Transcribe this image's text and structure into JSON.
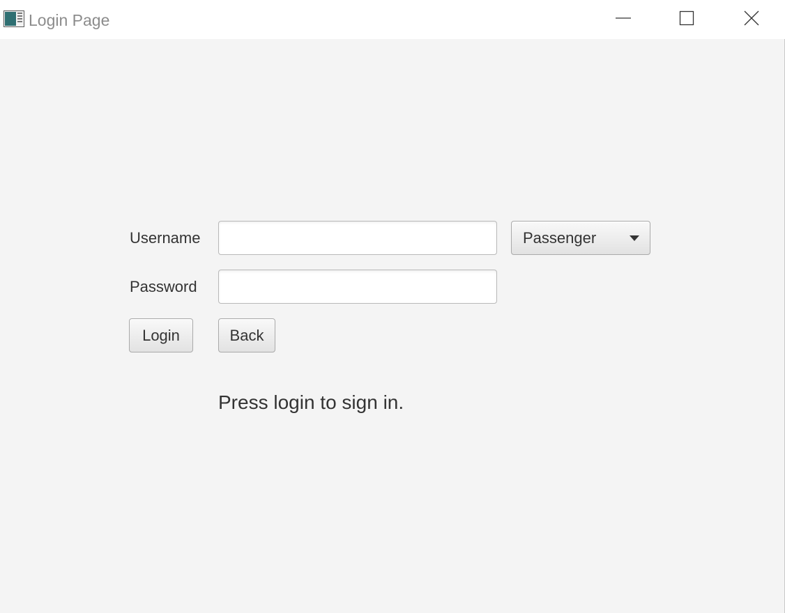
{
  "window": {
    "title": "Login Page",
    "icon": "app-window-icon",
    "controls": {
      "minimize_icon": "minimize-icon",
      "maximize_icon": "maximize-icon",
      "close_icon": "close-icon"
    }
  },
  "form": {
    "username_label": "Username",
    "username_value": "",
    "password_label": "Password",
    "password_value": "",
    "role_select": {
      "selected": "Passenger",
      "arrow_icon": "dropdown-arrow-icon"
    },
    "login_label": "Login",
    "back_label": "Back"
  },
  "status": {
    "message": "Press login to sign in."
  },
  "colors": {
    "background": "#f4f4f4",
    "titlebar": "#ffffff",
    "title_text": "#8c8c8c",
    "text": "#333333",
    "field_border": "#b8b8b8"
  }
}
